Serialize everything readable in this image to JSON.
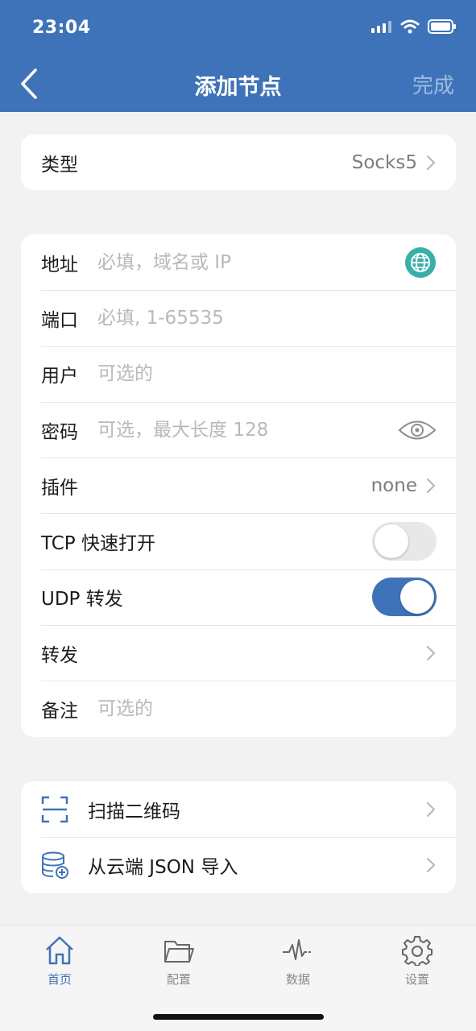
{
  "status": {
    "time": "23:04"
  },
  "nav": {
    "title": "添加节点",
    "done_label": "完成"
  },
  "type_row": {
    "label": "类型",
    "value": "Socks5"
  },
  "form": {
    "address": {
      "label": "地址",
      "placeholder": "必填，域名或 IP"
    },
    "port": {
      "label": "端口",
      "placeholder": "必填, 1-65535"
    },
    "user": {
      "label": "用户",
      "placeholder": "可选的"
    },
    "password": {
      "label": "密码",
      "placeholder": "可选，最大长度 128"
    },
    "plugin": {
      "label": "插件",
      "value": "none"
    },
    "tcp_fast_open": {
      "label": "TCP 快速打开",
      "enabled": false
    },
    "udp_forward": {
      "label": "UDP 转发",
      "enabled": true
    },
    "forward": {
      "label": "转发"
    },
    "note": {
      "label": "备注",
      "placeholder": "可选的"
    }
  },
  "import": {
    "scan_qr": {
      "label": "扫描二维码",
      "icon": "qr-scan-icon"
    },
    "from_cloud_json": {
      "label": "从云端 JSON 导入",
      "icon": "database-add-icon"
    }
  },
  "tabs": [
    {
      "label": "首页",
      "icon": "home-icon",
      "active": true
    },
    {
      "label": "配置",
      "icon": "folder-icon",
      "active": false
    },
    {
      "label": "数据",
      "icon": "pulse-icon",
      "active": false
    },
    {
      "label": "设置",
      "icon": "gear-icon",
      "active": false
    }
  ],
  "colors": {
    "accent": "#3f73b9",
    "globe": "#3aaea8"
  }
}
